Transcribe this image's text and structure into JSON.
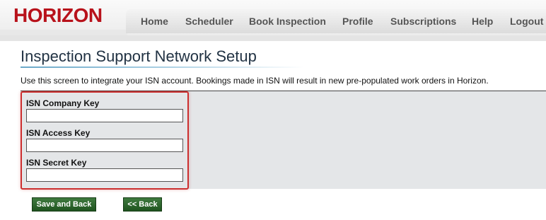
{
  "header": {
    "logo_text": "HORIZON",
    "brand_color": "#b8121b",
    "nav": {
      "home": "Home",
      "scheduler": "Scheduler",
      "book_inspection": "Book Inspection",
      "profile": "Profile",
      "subscriptions": "Subscriptions",
      "help": "Help",
      "logout": "Logout"
    }
  },
  "main": {
    "title": "Inspection Support Network Setup",
    "description": "Use this screen to integrate your ISN account. Bookings made in ISN will result in new pre-populated work orders in Horizon.",
    "fields": {
      "company_key": {
        "label": "ISN Company Key",
        "value": ""
      },
      "access_key": {
        "label": "ISN Access Key",
        "value": ""
      },
      "secret_key": {
        "label": "ISN Secret Key",
        "value": ""
      }
    },
    "highlight_color": "#cc2f2f"
  },
  "actions": {
    "save_label": "Save and Back",
    "back_label": "<< Back",
    "button_color": "#2f6a2f"
  }
}
